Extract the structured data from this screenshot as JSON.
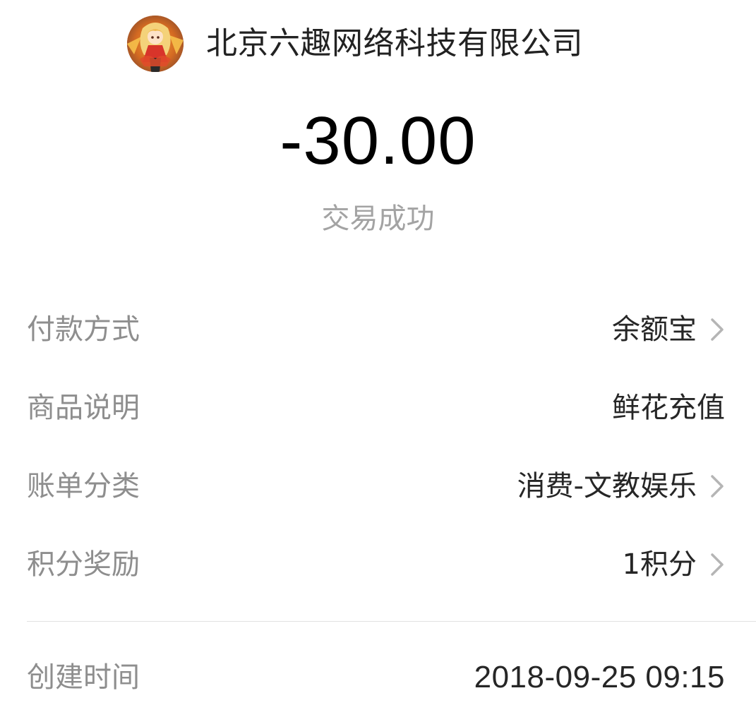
{
  "merchant": {
    "name": "北京六趣网络科技有限公司",
    "avatar_icon": "anime-character-avatar"
  },
  "transaction": {
    "amount": "-30.00",
    "status": "交易成功"
  },
  "details": {
    "payment_method": {
      "label": "付款方式",
      "value": "余额宝",
      "icon": "chevron-right-icon"
    },
    "product_description": {
      "label": "商品说明",
      "value": "鲜花充值"
    },
    "bill_category": {
      "label": "账单分类",
      "value": "消费-文教娱乐",
      "icon": "chevron-right-icon"
    },
    "points_reward": {
      "label": "积分奖励",
      "value": "1积分",
      "icon": "chevron-right-icon"
    }
  },
  "created": {
    "label": "创建时间",
    "value": "2018-09-25 09:15"
  },
  "colors": {
    "amount": "#000000",
    "status": "#a3a3a3",
    "label": "#8e8e8e",
    "value": "#262626",
    "chevron": "#b5b5b5",
    "divider": "#e2e2e2"
  }
}
